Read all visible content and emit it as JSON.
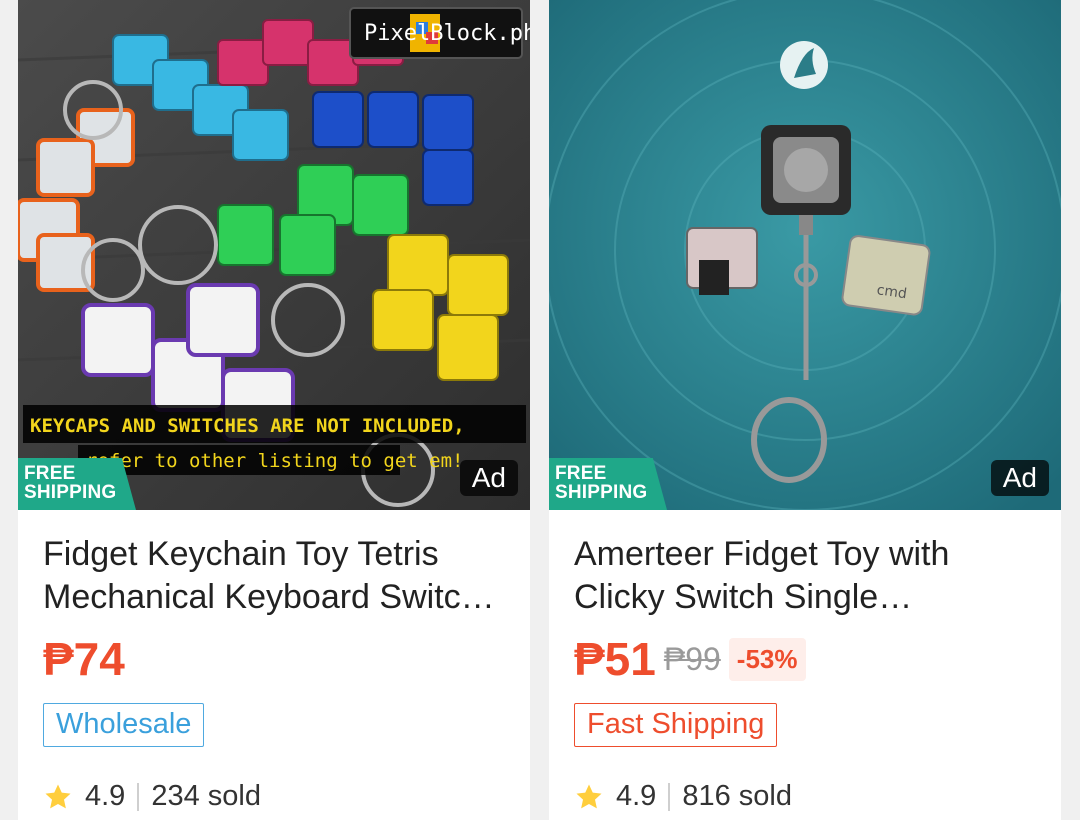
{
  "products": [
    {
      "image_overlay_brand": "PixelBlock.ph",
      "image_overlay_caption_1": "KEYCAPS AND SWITCHES ARE NOT INCLUDED,",
      "image_overlay_caption_2": "refer to other listing to get em!",
      "free_shipping_1": "FREE",
      "free_shipping_2": "SHIPPING",
      "ad_label": "Ad",
      "title": "Fidget Keychain Toy Tetris Mechanical Keyboard Switch Keycap",
      "price": "₱74",
      "tag": "Wholesale",
      "rating": "4.9",
      "sold": "234 sold",
      "tag_color": "#3aa0dc"
    },
    {
      "free_shipping_1": "FREE",
      "free_shipping_2": "SHIPPING",
      "ad_label": "Ad",
      "image_keycap_text": "cmd",
      "title": "Amerteer Fidget Toy with Clicky Switch Single Mechanical Keychain",
      "price": "₱51",
      "original_price": "₱99",
      "discount": "-53%",
      "tag": "Fast Shipping",
      "rating": "4.9",
      "sold": "816 sold",
      "tag_color": "#ee4d2d"
    }
  ],
  "colors": {
    "price": "#ee4d2d",
    "free_shipping": "#1fa889",
    "background": "#f0f0f0"
  }
}
